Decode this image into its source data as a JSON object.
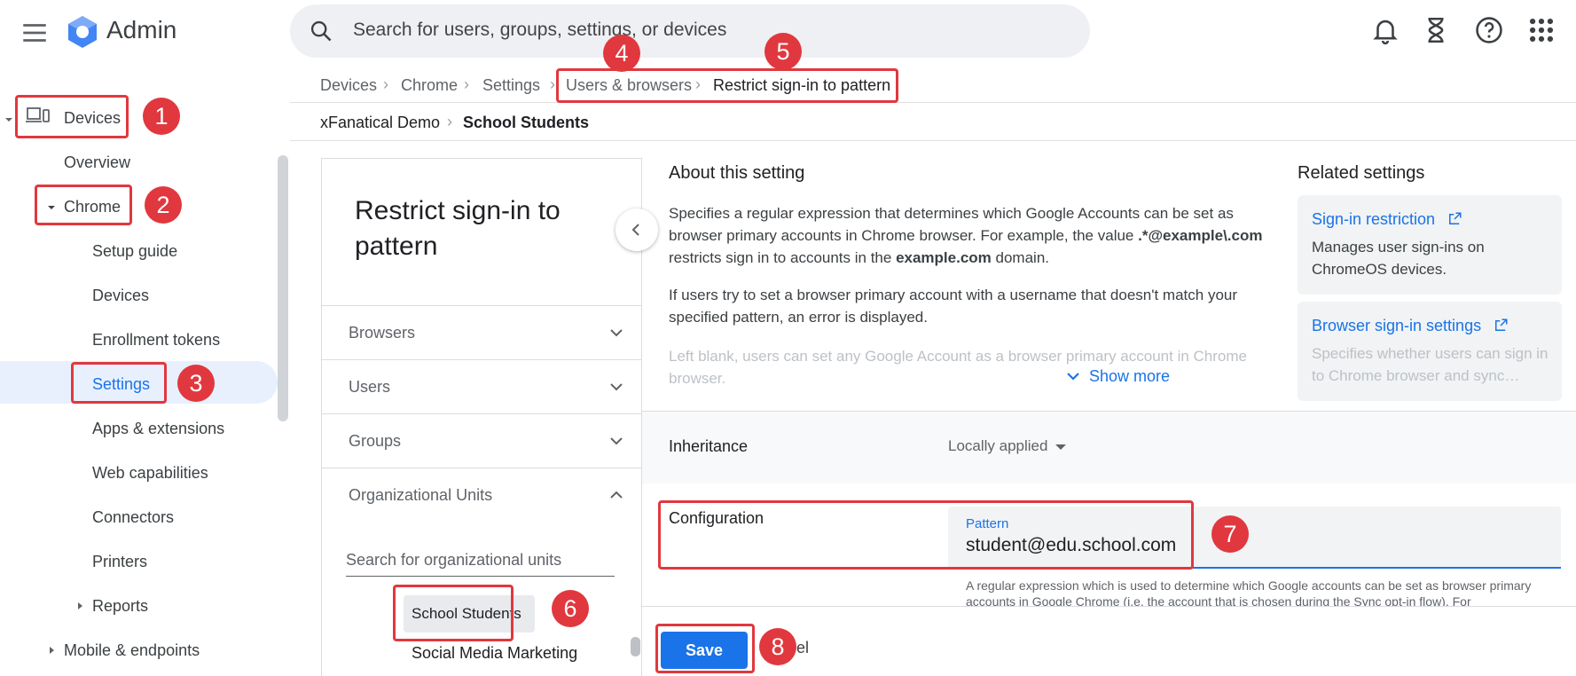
{
  "header": {
    "app_title": "Admin",
    "search_placeholder": "Search for users, groups, settings, or devices"
  },
  "breadcrumbs": {
    "path": [
      "Devices",
      "Chrome",
      "Settings",
      "Users & browsers",
      "Restrict sign-in to pattern"
    ],
    "org": [
      "xFanatical Demo",
      "School Students"
    ]
  },
  "sidebar": {
    "devices": "Devices",
    "overview": "Overview",
    "chrome": "Chrome",
    "chrome_items": [
      "Setup guide",
      "Devices",
      "Enrollment tokens",
      "Settings",
      "Apps & extensions",
      "Web capabilities",
      "Connectors",
      "Printers",
      "Reports"
    ],
    "mobile": "Mobile & endpoints"
  },
  "left_panel": {
    "title": "Restrict sign-in to pattern",
    "sections": [
      "Browsers",
      "Users",
      "Groups",
      "Organizational Units"
    ],
    "ou_search_placeholder": "Search for organizational units",
    "ou_selected": "School Students",
    "ou_other": "Social Media Marketing"
  },
  "about": {
    "title": "About this setting",
    "p1_a": "Specifies a regular expression that determines which Google Accounts can be set as browser primary accounts in Chrome browser. For example, the value ",
    "p1_code": ".*@example\\.com",
    "p1_b": " restricts sign in to accounts in the ",
    "p1_domain": "example.com",
    "p1_c": " domain.",
    "p2": "If users try to set a browser primary account with a username that doesn't match your specified pattern, an error is displayed.",
    "p3": "Left blank, users can set any Google Account as a browser primary account in Chrome browser.",
    "show_more": "Show more"
  },
  "related": {
    "title": "Related settings",
    "items": [
      {
        "link": "Sign-in restriction",
        "desc": "Manages user sign-ins on ChromeOS devices."
      },
      {
        "link": "Browser sign-in settings",
        "desc": "Specifies whether users can sign in to Chrome browser and sync…"
      }
    ]
  },
  "inheritance": {
    "label": "Inheritance",
    "value": "Locally applied"
  },
  "configuration": {
    "label": "Configuration",
    "field_label": "Pattern",
    "field_value": "student@edu.school.com",
    "helper": "A regular expression which is used to determine which Google accounts can be set as browser primary accounts in Google Chrome (i.e. the account that is chosen during the Sync opt-in flow). For"
  },
  "footer": {
    "save": "Save",
    "cancel": "Cancel"
  },
  "annotations": [
    "1",
    "2",
    "3",
    "4",
    "5",
    "6",
    "7",
    "8"
  ],
  "colors": {
    "accent": "#1a73e8",
    "annotation": "#e0383e",
    "selected_bg": "#e8f0fe"
  }
}
